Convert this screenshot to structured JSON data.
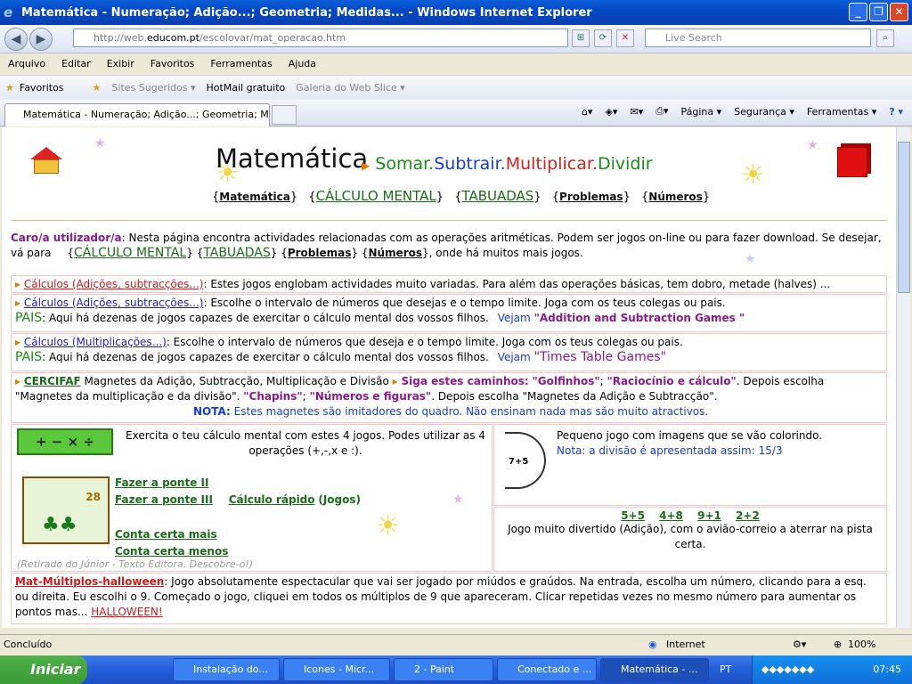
{
  "window": {
    "title": "Matemática - Numeração; Adição...; Geometria; Medidas... - Windows Internet Explorer"
  },
  "nav": {
    "url_prefix": "http://web.",
    "url_host": "educom.pt",
    "url_path": "/escolovar/mat_operacao.htm",
    "search_placeholder": "Live Search"
  },
  "menu": [
    "Arquivo",
    "Editar",
    "Exibir",
    "Favoritos",
    "Ferramentas",
    "Ajuda"
  ],
  "favbar": {
    "favoritos": "Favoritos",
    "items": [
      "Sites Sugeridos ▾",
      "HotMail gratuito",
      "Galeria do Web Slice ▾"
    ]
  },
  "tab": {
    "label": "Matemática - Numeração; Adição...; Geometria; Medi..."
  },
  "toolbar": {
    "pagina": "Página ▾",
    "seguranca": "Segurança ▾",
    "ferramentas": "Ferramentas ▾",
    "help": "? ▾"
  },
  "page": {
    "title": "Matemática",
    "ops": {
      "somar": "Somar.",
      "subtrair": "Subtrair.",
      "multiplicar": "Multiplicar.",
      "dividir": "Dividir"
    },
    "topnav": [
      {
        "l": "{",
        "t": "Matemática",
        "r": "}"
      },
      {
        "l": "{",
        "t": "CÁLCULO MENTAL",
        "r": "}"
      },
      {
        "l": "{",
        "t": "TABUADAS",
        "r": "}"
      },
      {
        "l": "{",
        "t": "Problemas",
        "r": "}"
      },
      {
        "l": "{",
        "t": "Números",
        "r": "}"
      }
    ],
    "intro": {
      "who": "Caro/a utilizador/a",
      "text1": ": Nesta página encontra actividades relacionadas com as operações aritméticas. Podem ser jogos on-line ou para fazer download. Se desejar, vá para",
      "calc": "CÁLCULO MENTAL",
      "tab": "TABUADAS",
      "prob": "Problemas",
      "num": "Números",
      "text2": ", onde há muitos mais jogos."
    },
    "row1": {
      "link": "Cálculos (Adições, subtracções...)",
      "text": ": Estes jogos englobam actividades muito variadas. Para além das operações básicas, tem dobro, metade (halves) ..."
    },
    "row2": {
      "link": "Cálculos (Adições, subtracções...)",
      "text": ": Escolhe o intervalo de números que desejas e o tempo limite. Joga com os teus colegas ou pais.",
      "pais": "PAIS",
      "pais_text": ": Aqui há dezenas de jogos capazes de exercitar o cálculo mental dos vossos filhos.",
      "vejam": "Vejam",
      "game": "\"Addition and Subtraction Games \""
    },
    "row3": {
      "link": "Cálculos (Multiplicações...)",
      "text": ": Escolhe o intervalo de números que deseja e o tempo limite. Joga com os teus colegas ou pais.",
      "pais": "PAIS",
      "pais_text": ": Aqui há dezenas de jogos capazes de exercitar o cálculo mental dos vossos filhos.",
      "vejam": "Vejam",
      "game": "\"Times Table Games\""
    },
    "row4": {
      "link": "CERCIFAF",
      "text": " Magnetes da Adição, Subtracção, Multiplicação e Divisão",
      "siga": "Siga estes caminhos:",
      "g1": "\"Golfinhos\"",
      "g2": "\"Raciocínio e cálculo\"",
      "t2": ". Depois escolha \"Magnetes da multiplicação e da divisão\".",
      "g3": "\"Chapins\"",
      "g4": "\"Números e figuras\"",
      "t3": ". Depois escolha \"Magnetes da Adição e Subtracção\".",
      "nota": "NOTA:",
      "nota_text": "Estes magnetes são imitadores do quadro. Não ensinam nada mas são muito atractivos."
    },
    "box_left": {
      "ops_icon": "+ − × ÷",
      "text": "Exercita o teu cálculo mental com estes 4 jogos. Podes utilizar as 4 operações (+,-,x e :).",
      "l1": "Fazer a ponte II",
      "l2": "Fazer a ponte III",
      "l3": "Cálculo rápido",
      "l3b": "(Jogos)",
      "l4": "Conta certa mais",
      "l5": "Conta certa menos",
      "credit": "(Retirado do Júnior - Texto Editora. Descobre-o!)",
      "thumb": "28"
    },
    "box_right": {
      "moon": "7+5",
      "text": "Pequeno jogo com imagens que se vão colorindo.",
      "nota": "Nota: a divisão é apresentada assim: 15/3",
      "sums": [
        "5+5",
        "4+8",
        "9+1",
        "2+2"
      ],
      "text2": "Jogo muito divertido (Adição), com o avião-correio a aterrar na pista certa."
    },
    "row5": {
      "link": "Mat-Múltiplos-halloween",
      "text": ": Jogo absolutamente espectacular que vai ser jogado por miúdos e graúdos. Na entrada, escolha um número, clicando para a esq. ou direita. Eu escolhi o 9. Começado o jogo, cliquei em todos os múltiplos de 9 que apareceram. Clicar repetidas vezes no mesmo número para aumentar os pontos mas...",
      "hw": "HALLOWEEN!"
    }
  },
  "status": {
    "left": "Concluído",
    "zone": "Internet",
    "zoom": "100%"
  },
  "taskbar": {
    "start": "Iniciar",
    "tasks": [
      "Instalação do...",
      "Icones - Micr...",
      "2 - Paint",
      "Conectado e ...",
      "Matemática - ..."
    ],
    "lang": "PT",
    "clock": "07:45"
  },
  "colors": {
    "ops_green": "#1a8a1a",
    "ops_blue": "#1a3acc",
    "ops_red": "#cc2222",
    "link_green": "#1a6b1a",
    "link_red": "#cc1a1a"
  }
}
